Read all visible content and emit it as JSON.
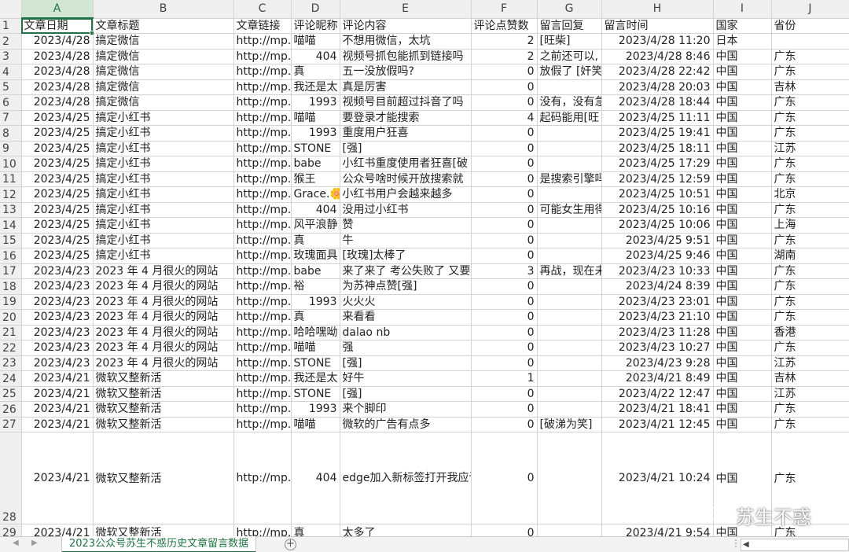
{
  "columns": [
    "A",
    "B",
    "C",
    "D",
    "E",
    "F",
    "G",
    "H",
    "I",
    "J"
  ],
  "rows": [
    {
      "n": "1",
      "cells": [
        "文章日期",
        "文章标题",
        "文章链接",
        "评论昵称",
        "评论内容",
        "评论点赞数",
        "留言回复",
        "留言时间",
        "国家",
        "省份"
      ]
    },
    {
      "n": "2",
      "cells": [
        "2023/4/28",
        "搞定微信",
        "http://mp.v",
        "喵喵",
        "不想用微信，太坑",
        "2",
        "[旺柴]",
        "2023/4/28 11:20",
        "日本",
        ""
      ]
    },
    {
      "n": "3",
      "cells": [
        "2023/4/28",
        "搞定微信",
        "http://mp.v",
        "404",
        "视频号抓包能抓到链接吗",
        "2",
        "之前还可以,",
        "2023/4/28 8:46",
        "中国",
        "广东"
      ]
    },
    {
      "n": "4",
      "cells": [
        "2023/4/28",
        "搞定微信",
        "http://mp.v",
        "真",
        "五一没放假吗?",
        "0",
        "放假了 [奸笑",
        "2023/4/28 22:42",
        "中国",
        "广东"
      ]
    },
    {
      "n": "5",
      "cells": [
        "2023/4/28",
        "搞定微信",
        "http://mp.v",
        "我还是太",
        "真是厉害",
        "0",
        "",
        "2023/4/28 20:03",
        "中国",
        "吉林"
      ]
    },
    {
      "n": "6",
      "cells": [
        "2023/4/28",
        "搞定微信",
        "http://mp.v",
        "1993",
        "视频号目前超过抖音了吗",
        "0",
        "没有，没有急",
        "2023/4/28 18:44",
        "中国",
        "广东"
      ]
    },
    {
      "n": "7",
      "cells": [
        "2023/4/25",
        "搞定小红书",
        "http://mp.v",
        "喵喵",
        "要登录才能搜索",
        "4",
        "起码能用[旺",
        "2023/4/25 11:11",
        "中国",
        "广东"
      ]
    },
    {
      "n": "8",
      "cells": [
        "2023/4/25",
        "搞定小红书",
        "http://mp.v",
        "1993",
        "重度用户狂喜",
        "0",
        "",
        "2023/4/25 19:41",
        "中国",
        "广东"
      ]
    },
    {
      "n": "9",
      "cells": [
        "2023/4/25",
        "搞定小红书",
        "http://mp.v",
        "STONE",
        "[强]",
        "0",
        "",
        "2023/4/25 18:11",
        "中国",
        "江苏"
      ]
    },
    {
      "n": "10",
      "cells": [
        "2023/4/25",
        "搞定小红书",
        "http://mp.v",
        "babe",
        "小红书重度使用者狂喜[破",
        "0",
        "",
        "2023/4/25 17:29",
        "中国",
        "广东"
      ]
    },
    {
      "n": "11",
      "cells": [
        "2023/4/25",
        "搞定小红书",
        "http://mp.v",
        "猴王",
        "公众号啥时候开放搜索就",
        "0",
        "是搜索引擎吗",
        "2023/4/25 12:59",
        "中国",
        "广东"
      ]
    },
    {
      "n": "12",
      "cells": [
        "2023/4/25",
        "搞定小红书",
        "http://mp.v",
        "Grace.🌼",
        "小红书用户会越来越多",
        "0",
        "",
        "2023/4/25 10:51",
        "中国",
        "北京"
      ]
    },
    {
      "n": "13",
      "cells": [
        "2023/4/25",
        "搞定小红书",
        "http://mp.v",
        "404",
        "没用过小红书",
        "0",
        "可能女生用得",
        "2023/4/25 10:16",
        "中国",
        "广东"
      ]
    },
    {
      "n": "14",
      "cells": [
        "2023/4/25",
        "搞定小红书",
        "http://mp.v",
        "风平浪静",
        "赞",
        "0",
        "",
        "2023/4/25 10:06",
        "中国",
        "上海"
      ]
    },
    {
      "n": "15",
      "cells": [
        "2023/4/25",
        "搞定小红书",
        "http://mp.v",
        "真",
        "牛",
        "0",
        "",
        "2023/4/25 9:51",
        "中国",
        "广东"
      ]
    },
    {
      "n": "16",
      "cells": [
        "2023/4/25",
        "搞定小红书",
        "http://mp.v",
        "玫瑰面具",
        "[玫瑰]太棒了",
        "0",
        "",
        "2023/4/25 9:46",
        "中国",
        "湖南"
      ]
    },
    {
      "n": "17",
      "cells": [
        "2023/4/23",
        "2023 年 4 月很火的网站",
        "http://mp.v",
        "babe",
        "来了来了 考公失败了 又要",
        "3",
        "再战，现在未",
        "2023/4/23 10:33",
        "中国",
        "广东"
      ]
    },
    {
      "n": "18",
      "cells": [
        "2023/4/23",
        "2023 年 4 月很火的网站",
        "http://mp.v",
        "裕",
        "为苏神点赞[强]",
        "0",
        "",
        "2023/4/24 8:39",
        "中国",
        "广东"
      ]
    },
    {
      "n": "19",
      "cells": [
        "2023/4/23",
        "2023 年 4 月很火的网站",
        "http://mp.v",
        "1993",
        "火火火",
        "0",
        "",
        "2023/4/23 23:01",
        "中国",
        "广东"
      ]
    },
    {
      "n": "20",
      "cells": [
        "2023/4/23",
        "2023 年 4 月很火的网站",
        "http://mp.v",
        "真",
        "来看看",
        "0",
        "",
        "2023/4/23 21:10",
        "中国",
        "广东"
      ]
    },
    {
      "n": "21",
      "cells": [
        "2023/4/23",
        "2023 年 4 月很火的网站",
        "http://mp.v",
        "哈哈嘿呦",
        "dalao nb",
        "0",
        "",
        "2023/4/23 11:28",
        "中国",
        "香港"
      ]
    },
    {
      "n": "22",
      "cells": [
        "2023/4/23",
        "2023 年 4 月很火的网站",
        "http://mp.v",
        "喵喵",
        "强",
        "0",
        "",
        "2023/4/23 10:27",
        "中国",
        "广东"
      ]
    },
    {
      "n": "23",
      "cells": [
        "2023/4/23",
        "2023 年 4 月很火的网站",
        "http://mp.v",
        "STONE",
        "[强]",
        "0",
        "",
        "2023/4/23 9:28",
        "中国",
        "江苏"
      ]
    },
    {
      "n": "24",
      "cells": [
        "2023/4/21",
        "微软又整新活",
        "http://mp.v",
        "我还是太",
        "好牛",
        "1",
        "",
        "2023/4/21 8:49",
        "中国",
        "吉林"
      ]
    },
    {
      "n": "25",
      "cells": [
        "2023/4/21",
        "微软又整新活",
        "http://mp.v",
        "STONE",
        "[强]",
        "0",
        "",
        "2023/4/22 12:47",
        "中国",
        "江苏"
      ]
    },
    {
      "n": "26",
      "cells": [
        "2023/4/21",
        "微软又整新活",
        "http://mp.v",
        "1993",
        "来个脚印",
        "0",
        "",
        "2023/4/21 18:41",
        "中国",
        "广东"
      ]
    },
    {
      "n": "27",
      "cells": [
        "2023/4/21",
        "微软又整新活",
        "http://mp.v",
        "喵喵",
        "微软的广告有点多",
        "0",
        "[破涕为笑]",
        "2023/4/21 12:45",
        "中国",
        "广东"
      ]
    },
    {
      "n": "28",
      "cells": [
        "2023/4/21",
        "微软又整新活",
        "http://mp.v",
        "404",
        "edge加入新标签打开我应该会考虑",
        "0",
        "",
        "2023/4/21 10:24",
        "中国",
        "广东"
      ]
    },
    {
      "n": "29",
      "cells": [
        "2023/4/21",
        "微软又整新活",
        "http://mp.v",
        "真",
        "太多了",
        "0",
        "",
        "2023/4/21 9:54",
        "中国",
        "广东"
      ]
    }
  ],
  "sheet_tab": "2023公众号苏生不惑历史文章留言数据",
  "add_sheet": "⊕",
  "watermark": "苏生不惑",
  "colors": {
    "accent": "#217346",
    "header_bg": "#efefef",
    "grid": "#d4d4d4"
  },
  "icons": {
    "add_sheet": "plus-circle-icon",
    "watermark": "wechat-icon"
  }
}
